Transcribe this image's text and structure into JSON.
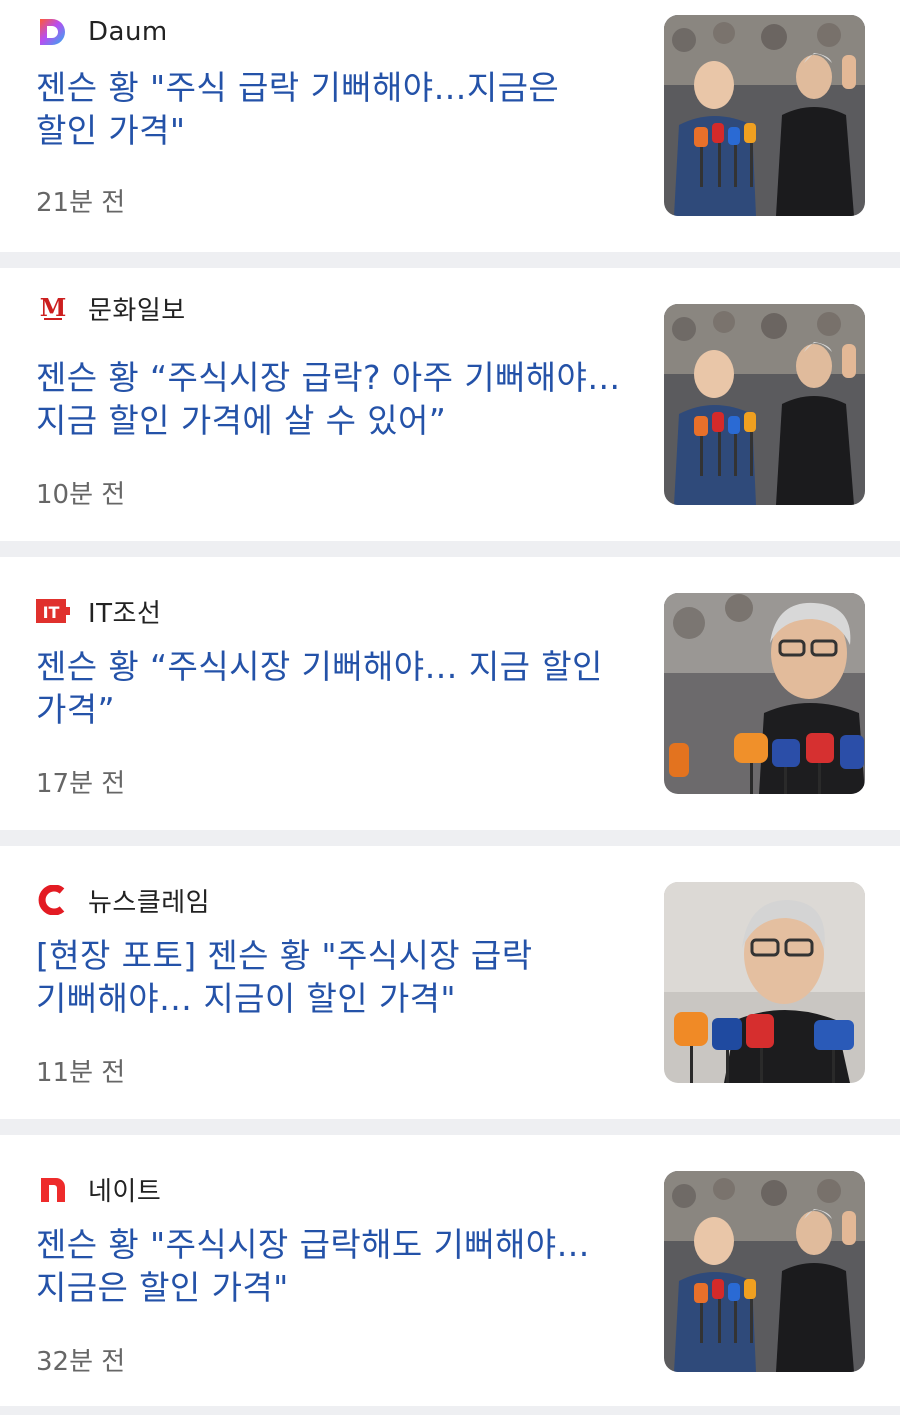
{
  "articles": [
    {
      "source": "Daum",
      "source_icon": "daum-logo-icon",
      "headline": "젠슨 황 \"주식 급락 기뻐해야…지금은 할인 가격\"",
      "time": "21분 전",
      "thumbnail": "press-crowd-photo"
    },
    {
      "source": "문화일보",
      "source_icon": "munhwa-logo-icon",
      "headline": "젠슨 황 “주식시장 급락? 아주 기뻐해야…지금 할인 가격에 살 수 있어”",
      "time": "10분 전",
      "thumbnail": "press-crowd-photo"
    },
    {
      "source": "IT조선",
      "source_icon": "itchosun-logo-icon",
      "headline": "젠슨 황 “주식시장 기뻐해야… 지금 할인 가격”",
      "time": "17분 전",
      "thumbnail": "press-closeup-photo"
    },
    {
      "source": "뉴스클레임",
      "source_icon": "newsclaim-logo-icon",
      "headline": "[현장 포토] 젠슨 황 \"주식시장 급락 기뻐해야… 지금이 할인 가격\"",
      "time": "11분 전",
      "thumbnail": "press-portrait-photo"
    },
    {
      "source": "네이트",
      "source_icon": "nate-logo-icon",
      "headline": "젠슨 황 \"주식시장 급락해도 기뻐해야…지금은 할인 가격\"",
      "time": "32분 전",
      "thumbnail": "press-crowd-photo"
    }
  ],
  "colors": {
    "headline": "#2452a8",
    "source_text": "#222222",
    "time_text": "#666666",
    "divider": "#eeeff2"
  }
}
